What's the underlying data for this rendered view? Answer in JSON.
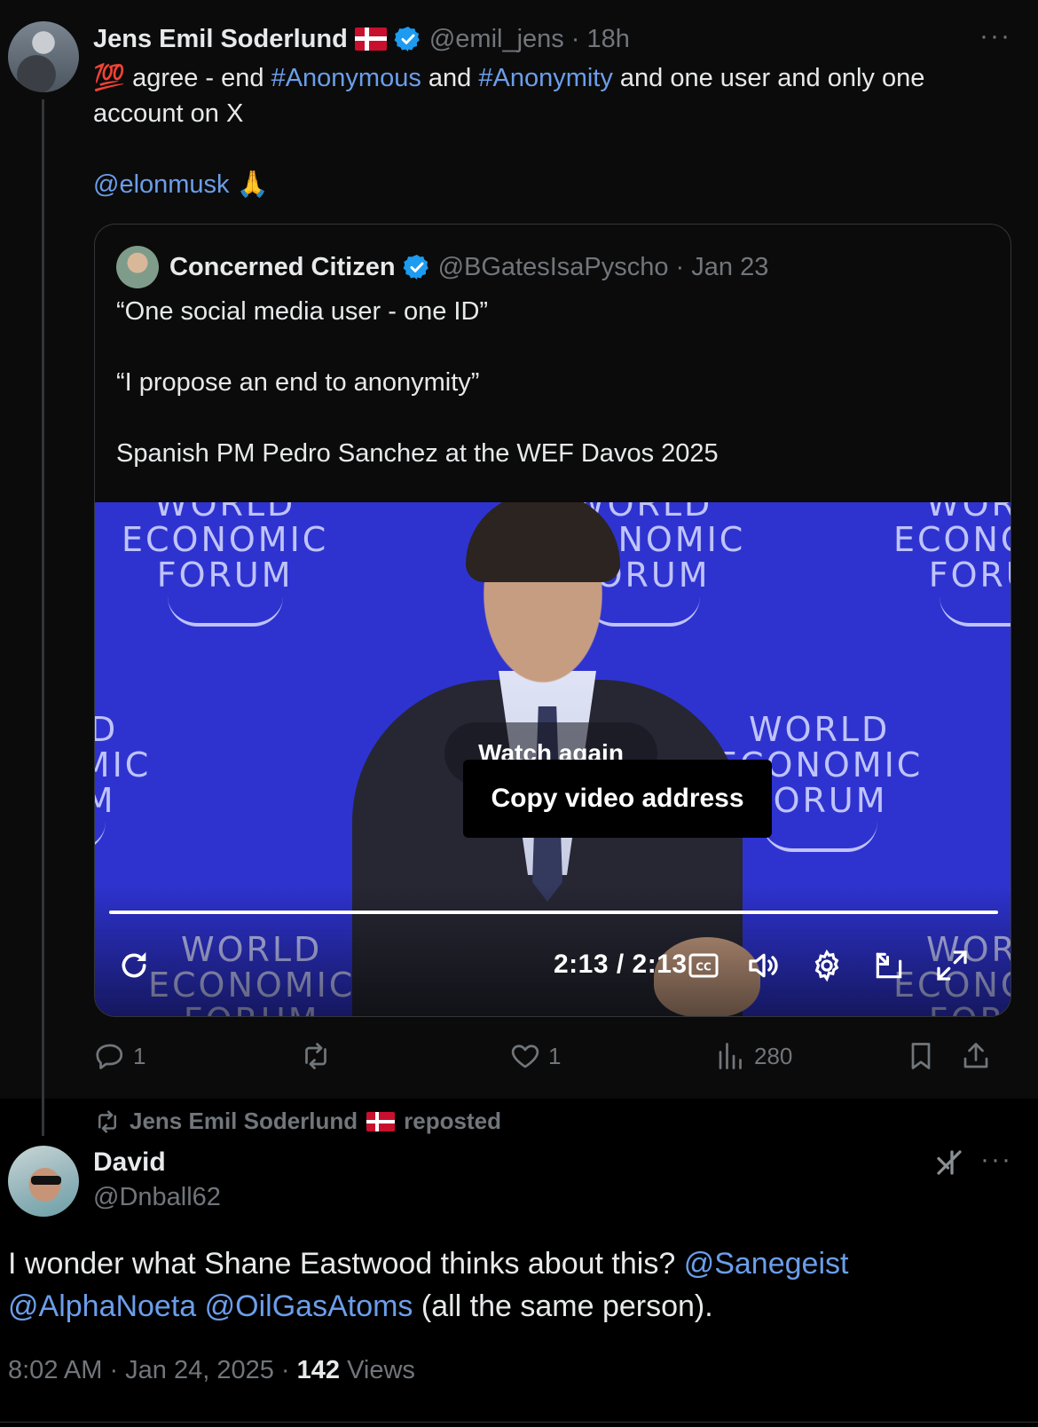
{
  "tweet": {
    "author_name": "Jens Emil Soderlund",
    "author_handle": "@emil_jens",
    "time": "· 18h",
    "more": "···",
    "text_emoji": "💯",
    "text_1": " agree - end ",
    "hashtag_1": "#Anonymous",
    "text_2": " and ",
    "hashtag_2": "#Anonymity",
    "text_3": " and one user and only one account on X",
    "mention": "@elonmusk",
    "mention_emoji": "🙏"
  },
  "quote": {
    "author_name": "Concerned Citizen",
    "author_handle": "@BGatesIsaPyscho",
    "time": "· Jan 23",
    "line_1": "“One social media user - one ID”",
    "line_2": "“I propose an end to anonymity”",
    "line_3": "Spanish PM Pedro Sanchez at the WEF Davos 2025",
    "video": {
      "background_text_1": "WORLD\nECONOMIC\nFORUM",
      "watch_again": "Watch again",
      "context_menu_item": "Copy video address",
      "time_display": "2:13 / 2:13",
      "progress": 1.0
    }
  },
  "actions": {
    "replies": "1",
    "reposts": "",
    "likes": "1",
    "views": "280"
  },
  "repost_banner": {
    "name": "Jens Emil Soderlund",
    "label": "reposted"
  },
  "tweet2": {
    "author_name": "David",
    "author_handle": "@Dnball62",
    "more": "···",
    "text_1": "I wonder what Shane Eastwood thinks about this? ",
    "mention_1": "@Sanegeist",
    "mention_2": "@AlphaNoeta",
    "mention_3": "@OilGasAtoms",
    "text_2": " (all the same person).",
    "timestamp": "8:02 AM · Jan 24, 2025 · ",
    "views_count": "142",
    "views_label": " Views"
  },
  "colors": {
    "link": "#6b9eea",
    "muted": "#71767b",
    "verified": "#1d9bf0",
    "wef_blue": "#2e33d0"
  }
}
